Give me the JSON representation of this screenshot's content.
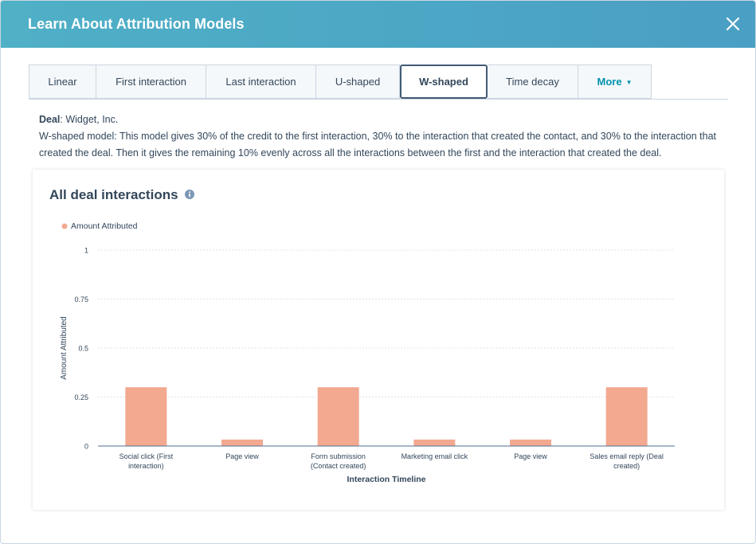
{
  "modal": {
    "title": "Learn About Attribution Models",
    "close_icon": "close-icon"
  },
  "tabs": [
    {
      "label": "Linear",
      "active": false
    },
    {
      "label": "First interaction",
      "active": false
    },
    {
      "label": "Last interaction",
      "active": false
    },
    {
      "label": "U-shaped",
      "active": false
    },
    {
      "label": "W-shaped",
      "active": true
    },
    {
      "label": "Time decay",
      "active": false
    },
    {
      "label": "More",
      "active": false,
      "dropdown": true
    }
  ],
  "deal": {
    "label": "Deal",
    "value": ": Widget, Inc."
  },
  "description": "W-shaped model: This model gives 30% of the credit to the first interaction, 30% to the interaction that created the contact, and 30% to the interaction that created the deal. Then it gives the remaining 10% evenly across all the interactions between the first and the interaction that created the deal.",
  "card": {
    "title": "All deal interactions",
    "info_icon": "info-icon"
  },
  "colors": {
    "header": "#4aa6c5",
    "bar": "#f2a990",
    "text": "#33475b",
    "link": "#0091ae"
  },
  "chart_data": {
    "type": "bar",
    "legend": [
      "Amount Attributed"
    ],
    "legend_position": "top-left",
    "categories": [
      [
        "Social click (First",
        "interaction)"
      ],
      [
        "Page view"
      ],
      [
        "Form submission",
        "(Contact created)"
      ],
      [
        "Marketing email click"
      ],
      [
        "Page view"
      ],
      [
        "Sales email reply (Deal",
        "created)"
      ]
    ],
    "series": [
      {
        "name": "Amount Attributed",
        "values": [
          0.3,
          0.033,
          0.3,
          0.033,
          0.033,
          0.3
        ]
      }
    ],
    "ylabel": "Amount Attributed",
    "xlabel": "Interaction Timeline",
    "yticks": [
      "0",
      "0.25",
      "0.5",
      "0.75",
      "1"
    ],
    "ylim": [
      0,
      1
    ],
    "grid": true
  }
}
